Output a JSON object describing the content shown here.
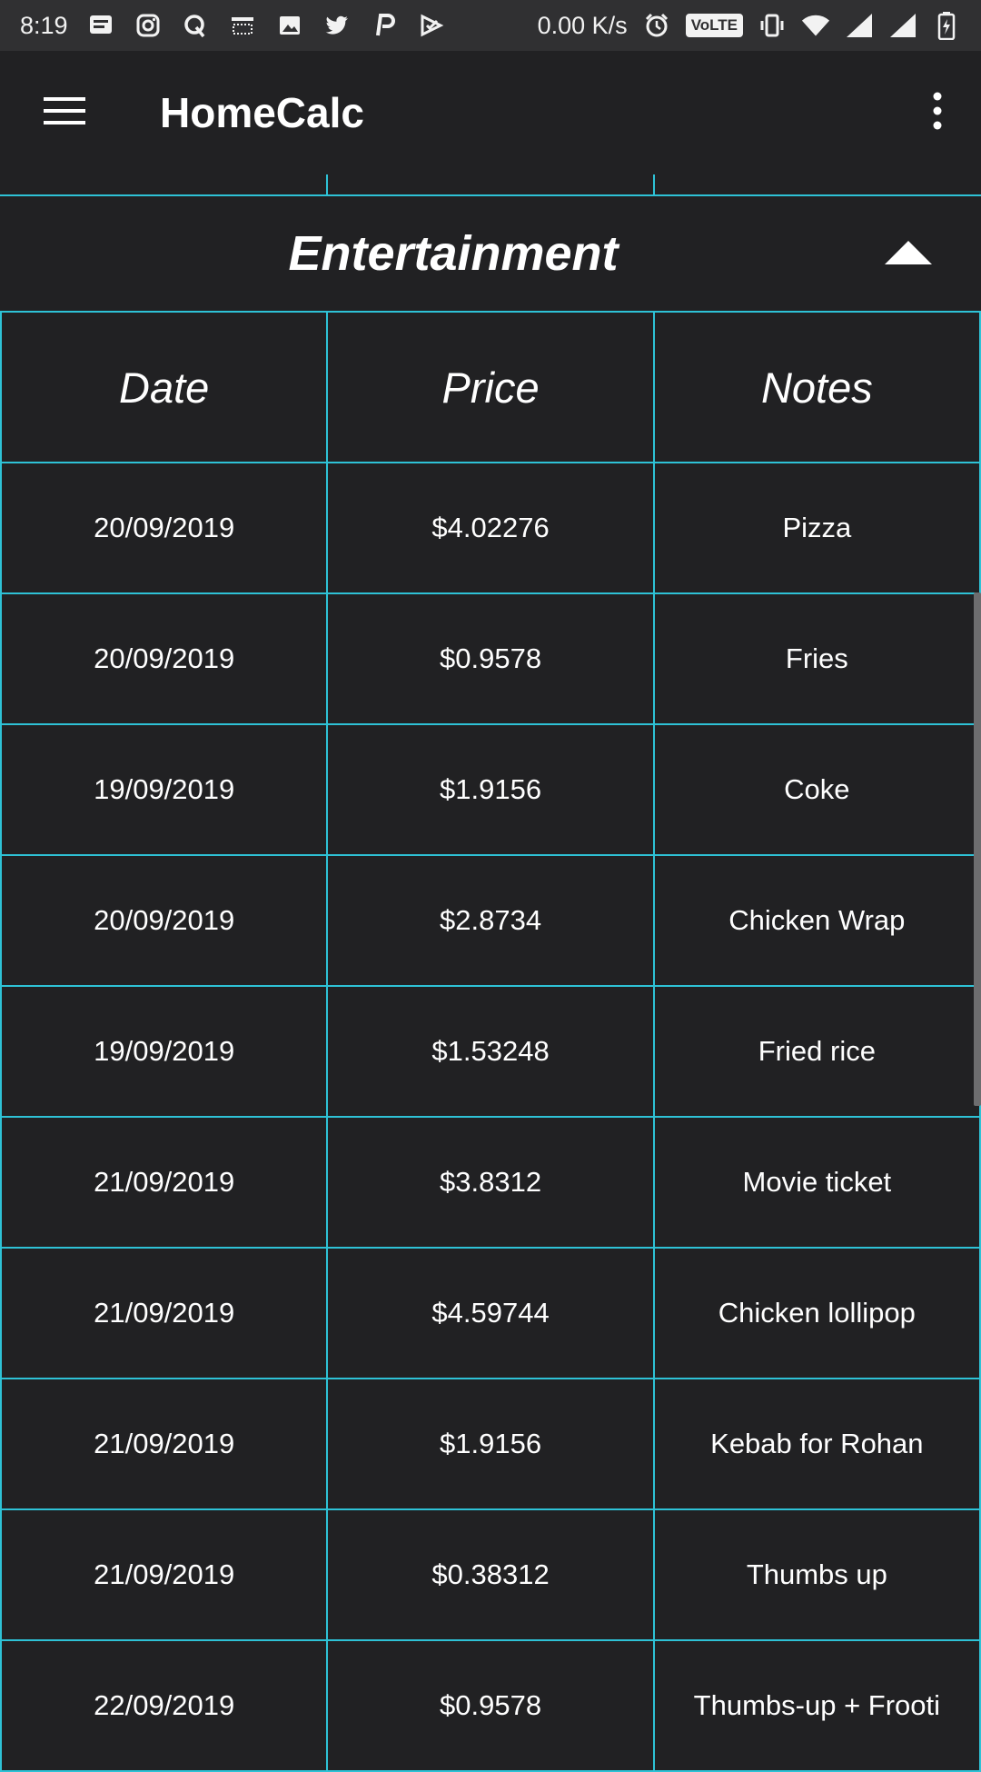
{
  "status_bar": {
    "time": "8:19",
    "net_speed": "0.00 K/s",
    "volte_label": "VoLTE",
    "left_icons": [
      "message-icon",
      "instagram-icon",
      "quora-icon",
      "amazon-icon",
      "gallery-icon",
      "twitter-icon",
      "paytm-icon",
      "tasks-icon"
    ],
    "right_icons": [
      "alarm-icon",
      "vibrate-icon",
      "wifi-icon",
      "signal-icon",
      "signal-icon",
      "battery-icon"
    ]
  },
  "app_bar": {
    "title": "HomeCalc",
    "menu_icon": "hamburger-icon",
    "more_icon": "more-vert-icon"
  },
  "section": {
    "title": "Entertainment",
    "collapse_icon": "caret-up-icon"
  },
  "table": {
    "headers": [
      "Date",
      "Price",
      "Notes"
    ],
    "rows": [
      [
        "20/09/2019",
        "$4.02276",
        "Pizza"
      ],
      [
        "20/09/2019",
        "$0.9578",
        "Fries"
      ],
      [
        "19/09/2019",
        "$1.9156",
        "Coke"
      ],
      [
        "20/09/2019",
        "$2.8734",
        "Chicken Wrap"
      ],
      [
        "19/09/2019",
        "$1.53248",
        "Fried rice"
      ],
      [
        "21/09/2019",
        "$3.8312",
        "Movie ticket"
      ],
      [
        "21/09/2019",
        "$4.59744",
        "Chicken lollipop"
      ],
      [
        "21/09/2019",
        "$1.9156",
        "Kebab for Rohan"
      ],
      [
        "21/09/2019",
        "$0.38312",
        "Thumbs up"
      ],
      [
        "22/09/2019",
        "$0.9578",
        "Thumbs-up + Frooti"
      ]
    ]
  },
  "colors": {
    "background": "#212123",
    "status_bar": "#303032",
    "grid_line": "#2ec2d6",
    "text": "#ffffff"
  }
}
